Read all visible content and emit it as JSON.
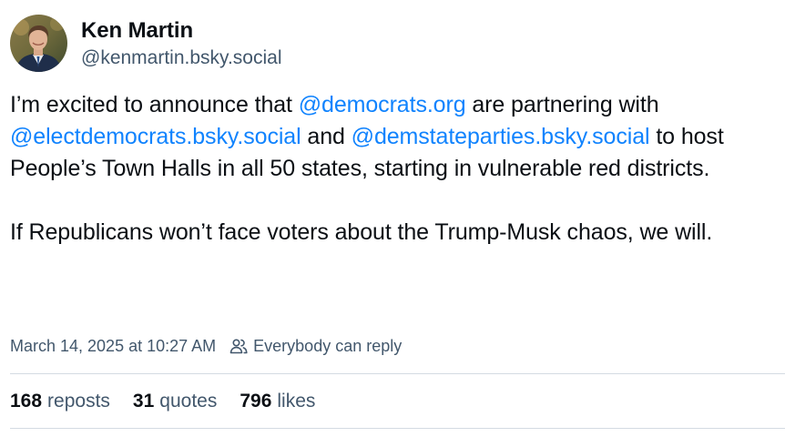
{
  "author": {
    "display_name": "Ken Martin",
    "handle": "@kenmartin.bsky.social"
  },
  "post": {
    "paragraph1": [
      {
        "text": "I’m excited to announce that ",
        "mention": false
      },
      {
        "text": "@democrats.org",
        "mention": true
      },
      {
        "text": " are partnering with ",
        "mention": false
      },
      {
        "text": "@electdemocrats.bsky.social",
        "mention": true
      },
      {
        "text": " and ",
        "mention": false
      },
      {
        "text": "@demstateparties.bsky.social",
        "mention": true
      },
      {
        "text": " to host People’s Town Halls in all 50 states, starting in vulnerable red districts.",
        "mention": false
      }
    ],
    "paragraph2": "If Republicans won’t face voters about the Trump-Musk chaos, we will."
  },
  "meta": {
    "timestamp": "March 14, 2025 at 10:27 AM",
    "reply_setting": "Everybody can reply",
    "reply_icon": "people-icon"
  },
  "stats": {
    "reposts_count": "168",
    "reposts_label": "reposts",
    "quotes_count": "31",
    "quotes_label": "quotes",
    "likes_count": "796",
    "likes_label": "likes"
  },
  "colors": {
    "mention": "#1083fe",
    "muted": "#42576c",
    "text": "#0b0f14",
    "divider": "#d4dbe2"
  }
}
